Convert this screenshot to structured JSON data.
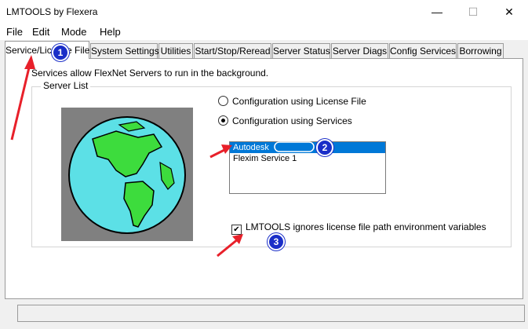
{
  "window": {
    "title": "LMTOOLS by Flexera",
    "minimize_glyph": "—",
    "maximize_glyph": "☐",
    "close_glyph": "✕"
  },
  "menu": [
    "File",
    "Edit",
    "Mode",
    "Help"
  ],
  "tabs": [
    {
      "label": "Service/License File",
      "active": true
    },
    {
      "label": "System Settings",
      "active": false
    },
    {
      "label": "Utilities",
      "active": false
    },
    {
      "label": "Start/Stop/Reread",
      "active": false
    },
    {
      "label": "Server Status",
      "active": false
    },
    {
      "label": "Server Diags",
      "active": false
    },
    {
      "label": "Config Services",
      "active": false
    },
    {
      "label": "Borrowing",
      "active": false
    }
  ],
  "description": "Services allow FlexNet Servers to run in the background.",
  "server_list": {
    "group_label": "Server List",
    "radio_license_file": {
      "label": "Configuration using License File",
      "selected": false
    },
    "radio_services": {
      "label": "Configuration using Services",
      "selected": true
    },
    "services": [
      {
        "name": "Autodesk",
        "selected": true
      },
      {
        "name": "Flexim Service 1",
        "selected": false
      }
    ],
    "ignore_env_checkbox": {
      "label": "LMTOOLS ignores license file path environment variables",
      "checked": true
    }
  },
  "annotations": {
    "badges": [
      "1",
      "2",
      "3"
    ],
    "arrow_color": "#e8202a",
    "badge_color": "#1a2ec8"
  }
}
